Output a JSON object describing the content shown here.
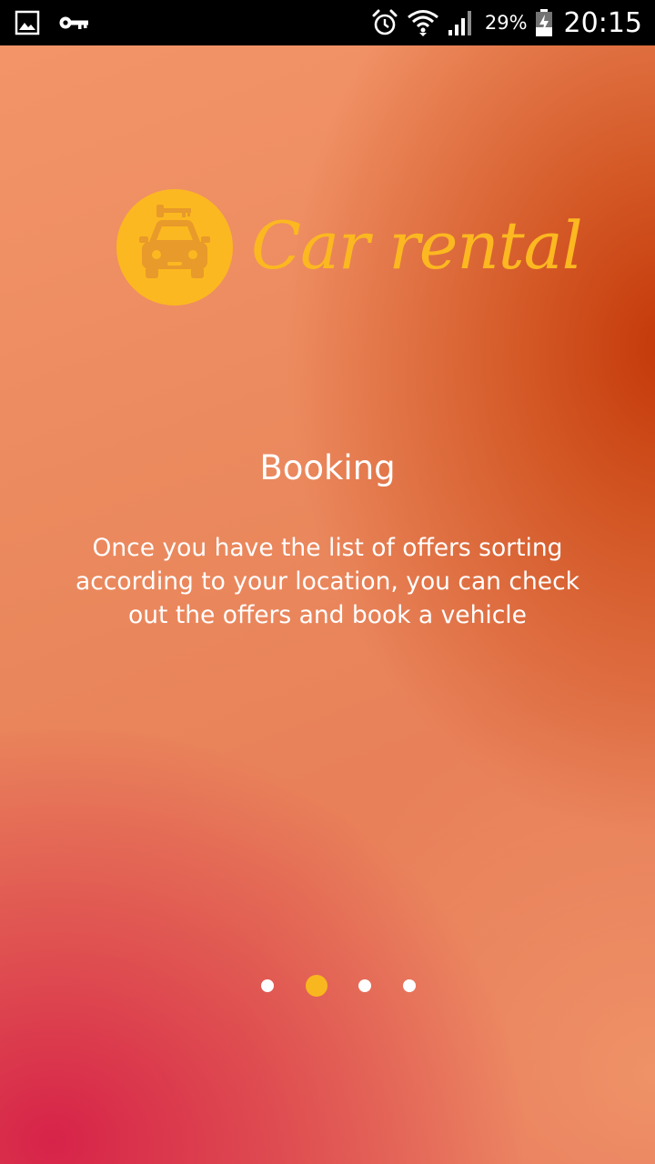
{
  "status_bar": {
    "left_icons": [
      "gallery-icon",
      "vpn-key-icon"
    ],
    "right_icons": [
      "alarm-icon",
      "wifi-icon",
      "signal-icon",
      "battery-charging-icon"
    ],
    "battery_percent": "29%",
    "time": "20:15"
  },
  "app": {
    "logo_text": "Car rental",
    "logo_icon": "car-key-badge-icon",
    "brand_color": "#fcb820"
  },
  "intro": {
    "title": "Booking",
    "description": "Once you have the list of offers sorting according to your location, you can check out the offers and book a vehicle",
    "pages": 4,
    "current_page": 2,
    "active_dot_color": "#f8b71e"
  }
}
